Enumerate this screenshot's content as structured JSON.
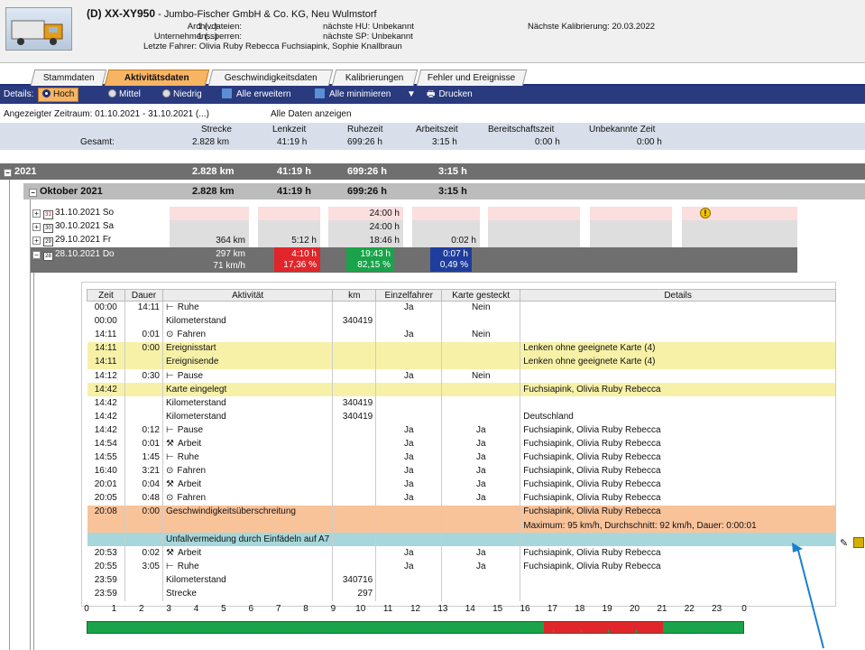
{
  "header": {
    "plate": "(D) XX-XY950",
    "company": "- Jumbo-Fischer GmbH & Co. KG, Neu Wulmstorf",
    "archive_label": "Archivdateien:",
    "archive_value": "1 (...)",
    "blocks_label": "Unternehmenssperren:",
    "blocks_value": "1 (...)",
    "drivers_label": "Letzte Fahrer:",
    "drivers_value": "Olivia Ruby Rebecca Fuchsiapink, Sophie Knallbraun",
    "hu_label": "nächste HU:",
    "hu_value": "Unbekannt",
    "sp_label": "nächste SP:",
    "sp_value": "Unbekannt",
    "calib_label": "Nächste Kalibrierung:",
    "calib_value": "20.03.2022"
  },
  "tabs": [
    "Stammdaten",
    "Aktivitätsdaten",
    "Geschwindigkeitsdaten",
    "Kalibrierungen",
    "Fehler und Ereignisse"
  ],
  "toolbar": {
    "details_label": "Details:",
    "hoch": "Hoch",
    "mittel": "Mittel",
    "niedrig": "Niedrig",
    "expand": "Alle erweitern",
    "collapse": "Alle minimieren",
    "print": "Drucken"
  },
  "period": {
    "label": "Angezeigter Zeitraum:",
    "value": "01.10.2021 - 31.10.2021 (...)",
    "all": "Alle Daten anzeigen"
  },
  "summary": {
    "headers": [
      "Strecke",
      "Lenkzeit",
      "Ruhezeit",
      "Arbeitszeit",
      "Bereitschaftszeit",
      "Unbekannte Zeit"
    ],
    "label": "Gesamt:",
    "values": [
      "2.828 km",
      "41:19 h",
      "699:26 h",
      "3:15 h",
      "0:00 h",
      "0:00 h"
    ]
  },
  "year": {
    "label": "2021",
    "values": [
      "2.828 km",
      "41:19 h",
      "699:26 h",
      "3:15 h"
    ]
  },
  "month": {
    "label": "Oktober 2021",
    "values": [
      "2.828 km",
      "41:19 h",
      "699:26 h",
      "3:15 h"
    ]
  },
  "days": [
    {
      "label": "31.10.2021 So",
      "cal": "31",
      "km": "",
      "lenk": "",
      "ruhe": "24:00 h",
      "arbeit": ""
    },
    {
      "label": "30.10.2021 Sa",
      "cal": "30",
      "km": "",
      "lenk": "",
      "ruhe": "24:00 h",
      "arbeit": ""
    },
    {
      "label": "29.10.2021 Fr",
      "cal": "29",
      "km": "364 km",
      "lenk": "5:12 h",
      "ruhe": "18:46 h",
      "arbeit": "0:02 h"
    },
    {
      "label": "28.10.2021 Do",
      "cal": "28",
      "km": "297 km",
      "km2": "71 km/h",
      "lenk": "4:10 h",
      "lenk2": "17,36 %",
      "ruhe": "19:43 h",
      "ruhe2": "82,15 %",
      "arbeit": "0:07 h",
      "arbeit2": "0,49 %"
    }
  ],
  "detail_headers": [
    "Zeit",
    "Dauer",
    "Aktivität",
    "km",
    "Einzelfahrer",
    "Karte gesteckt",
    "Details"
  ],
  "detail_rows": [
    {
      "t": "00:00",
      "d": "14:11",
      "ico": "⊢",
      "a": "Ruhe",
      "km": "",
      "e": "Ja",
      "k": "Nein",
      "det": "",
      "c": ""
    },
    {
      "t": "00:00",
      "d": "",
      "ico": "",
      "a": "Kilometerstand",
      "km": "340419",
      "e": "",
      "k": "",
      "det": "",
      "c": ""
    },
    {
      "t": "14:11",
      "d": "0:01",
      "ico": "⊙",
      "a": "Fahren",
      "km": "",
      "e": "Ja",
      "k": "Nein",
      "det": "",
      "c": ""
    },
    {
      "t": "14:11",
      "d": "0:00",
      "ico": "",
      "a": "Ereignisstart",
      "km": "",
      "e": "",
      "k": "",
      "det": "Lenken ohne geeignete Karte (4)",
      "c": "y"
    },
    {
      "t": "14:11",
      "d": "",
      "ico": "",
      "a": "Ereignisende",
      "km": "",
      "e": "",
      "k": "",
      "det": "Lenken ohne geeignete Karte (4)",
      "c": "y"
    },
    {
      "t": "14:12",
      "d": "0:30",
      "ico": "⊢",
      "a": "Pause",
      "km": "",
      "e": "Ja",
      "k": "Nein",
      "det": "",
      "c": ""
    },
    {
      "t": "14:42",
      "d": "",
      "ico": "",
      "a": "Karte eingelegt",
      "km": "",
      "e": "",
      "k": "",
      "det": "Fuchsiapink, Olivia Ruby Rebecca",
      "c": "y"
    },
    {
      "t": "14:42",
      "d": "",
      "ico": "",
      "a": "Kilometerstand",
      "km": "340419",
      "e": "",
      "k": "",
      "det": "",
      "c": ""
    },
    {
      "t": "14:42",
      "d": "",
      "ico": "",
      "a": "Kilometerstand",
      "km": "340419",
      "e": "",
      "k": "",
      "det": "Deutschland",
      "c": ""
    },
    {
      "t": "14:42",
      "d": "0:12",
      "ico": "⊢",
      "a": "Pause",
      "km": "",
      "e": "Ja",
      "k": "Ja",
      "det": "Fuchsiapink, Olivia Ruby Rebecca",
      "c": ""
    },
    {
      "t": "14:54",
      "d": "0:01",
      "ico": "⚒",
      "a": "Arbeit",
      "km": "",
      "e": "Ja",
      "k": "Ja",
      "det": "Fuchsiapink, Olivia Ruby Rebecca",
      "c": ""
    },
    {
      "t": "14:55",
      "d": "1:45",
      "ico": "⊢",
      "a": "Ruhe",
      "km": "",
      "e": "Ja",
      "k": "Ja",
      "det": "Fuchsiapink, Olivia Ruby Rebecca",
      "c": ""
    },
    {
      "t": "16:40",
      "d": "3:21",
      "ico": "⊙",
      "a": "Fahren",
      "km": "",
      "e": "Ja",
      "k": "Ja",
      "det": "Fuchsiapink, Olivia Ruby Rebecca",
      "c": ""
    },
    {
      "t": "20:01",
      "d": "0:04",
      "ico": "⚒",
      "a": "Arbeit",
      "km": "",
      "e": "Ja",
      "k": "Ja",
      "det": "Fuchsiapink, Olivia Ruby Rebecca",
      "c": ""
    },
    {
      "t": "20:05",
      "d": "0:48",
      "ico": "⊙",
      "a": "Fahren",
      "km": "",
      "e": "Ja",
      "k": "Ja",
      "det": "Fuchsiapink, Olivia Ruby Rebecca",
      "c": ""
    },
    {
      "t": "20:08",
      "d": "0:00",
      "ico": "",
      "a": "Geschwindigkeitsüberschreitung",
      "km": "",
      "e": "",
      "k": "",
      "det": "Fuchsiapink, Olivia Ruby Rebecca",
      "c": "o"
    },
    {
      "t": "",
      "d": "",
      "ico": "",
      "a": "",
      "km": "",
      "e": "",
      "k": "",
      "det": "Maximum: 95 km/h,  Durchschnitt: 92 km/h,  Dauer: 0:00:01",
      "c": "o"
    },
    {
      "t": "",
      "d": "",
      "ico": "",
      "a": "Unfallvermeidung durch Einfädeln auf A7",
      "km": "",
      "e": "",
      "k": "",
      "det": "",
      "c": "b"
    },
    {
      "t": "20:53",
      "d": "0:02",
      "ico": "⚒",
      "a": "Arbeit",
      "km": "",
      "e": "Ja",
      "k": "Ja",
      "det": "Fuchsiapink, Olivia Ruby Rebecca",
      "c": ""
    },
    {
      "t": "20:55",
      "d": "3:05",
      "ico": "⊢",
      "a": "Ruhe",
      "km": "",
      "e": "Ja",
      "k": "Ja",
      "det": "Fuchsiapink, Olivia Ruby Rebecca",
      "c": ""
    },
    {
      "t": "23:59",
      "d": "",
      "ico": "",
      "a": "Kilometerstand",
      "km": "340716",
      "e": "",
      "k": "",
      "det": "",
      "c": ""
    },
    {
      "t": "23:59",
      "d": "",
      "ico": "",
      "a": "Strecke",
      "km": "297",
      "e": "",
      "k": "",
      "det": "",
      "c": ""
    }
  ],
  "timeline": {
    "ticks": [
      "0",
      "1",
      "2",
      "3",
      "4",
      "5",
      "6",
      "7",
      "8",
      "9",
      "10",
      "11",
      "12",
      "13",
      "14",
      "15",
      "16",
      "17",
      "18",
      "19",
      "20",
      "21",
      "22",
      "23",
      "0"
    ],
    "segments": [
      {
        "from_h": 16.67,
        "to_h": 21.0,
        "color": "#e0262b"
      }
    ],
    "base_color": "#1aa34a"
  },
  "colors": {
    "accent": "#f7b463",
    "toolbar": "#2a3a7e",
    "lenk": "#e0262b",
    "ruhe": "#1aa34a",
    "arbeit": "#1f3d9c"
  }
}
